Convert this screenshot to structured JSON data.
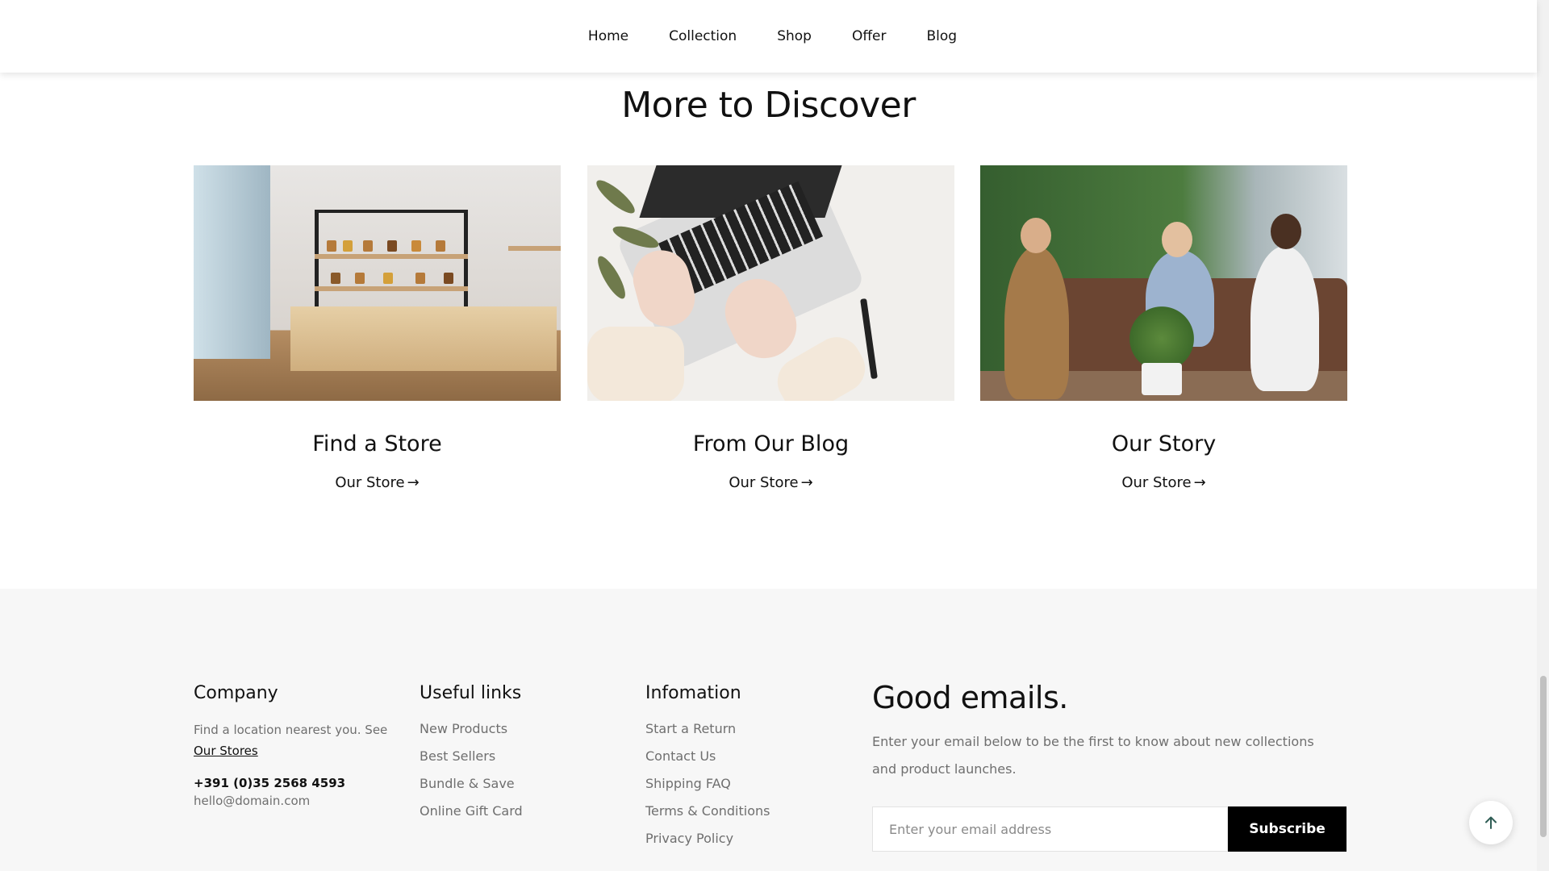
{
  "nav": {
    "items": [
      {
        "label": "Home"
      },
      {
        "label": "Collection"
      },
      {
        "label": "Shop"
      },
      {
        "label": "Offer"
      },
      {
        "label": "Blog"
      }
    ]
  },
  "discover": {
    "title": "More to Discover",
    "cards": [
      {
        "title": "Find a Store",
        "link": "Our Store",
        "arrow": "→",
        "image": "store-shelves-photo"
      },
      {
        "title": "From Our Blog",
        "link": "Our Store",
        "arrow": "→",
        "image": "laptop-typing-photo"
      },
      {
        "title": "Our Story",
        "link": "Our Store",
        "arrow": "→",
        "image": "team-meeting-photo"
      }
    ]
  },
  "footer": {
    "company": {
      "title": "Company",
      "text": "Find a location nearest you. See",
      "link": "Our Stores",
      "phone": "+391 (0)35 2568 4593",
      "email": "hello@domain.com"
    },
    "useful_links": {
      "title": "Useful links",
      "items": [
        "New Products",
        "Best Sellers",
        "Bundle & Save",
        "Online Gift Card"
      ]
    },
    "information": {
      "title": "Infomation",
      "items": [
        "Start a Return",
        "Contact Us",
        "Shipping FAQ",
        "Terms & Conditions",
        "Privacy Policy"
      ]
    },
    "newsletter": {
      "title": "Good emails.",
      "description": "Enter your email below to be the first to know about new collections and product launches.",
      "placeholder": "Enter your email address",
      "button": "Subscribe"
    }
  },
  "back_to_top": {
    "icon": "arrow-up-icon"
  },
  "colors": {
    "accent": "#000000",
    "footer_bg": "#f7f7f7",
    "muted_text": "#6f6f6f"
  }
}
